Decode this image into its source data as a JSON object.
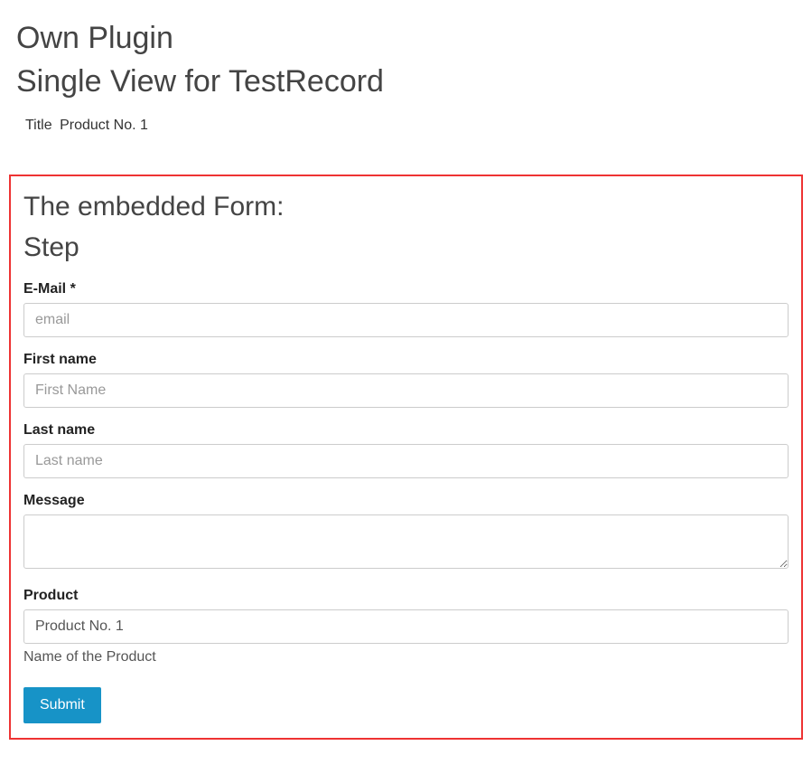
{
  "header": {
    "title": "Own Plugin",
    "subtitle": "Single View for TestRecord",
    "titleLabel": "Title",
    "titleValue": "Product No. 1"
  },
  "form": {
    "heading": "The embedded Form:",
    "step": "Step",
    "fields": {
      "email": {
        "label": "E-Mail *",
        "placeholder": "email"
      },
      "firstName": {
        "label": "First name",
        "placeholder": "First Name"
      },
      "lastName": {
        "label": "Last name",
        "placeholder": "Last name"
      },
      "message": {
        "label": "Message"
      },
      "product": {
        "label": "Product",
        "value": "Product No. 1",
        "help": "Name of the Product"
      }
    },
    "submit": "Submit"
  }
}
